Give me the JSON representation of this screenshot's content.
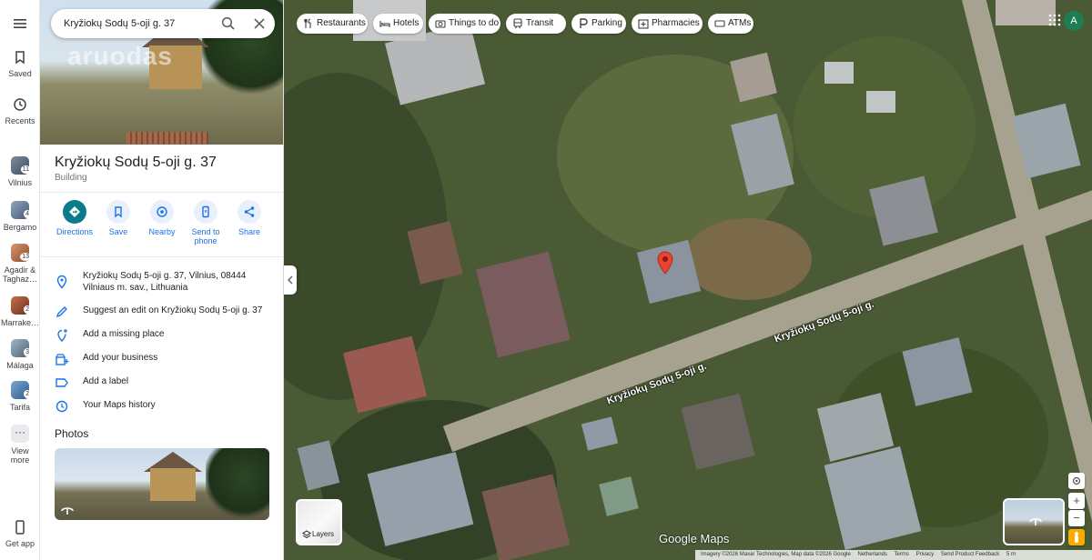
{
  "search": {
    "value": "Kryžiokų Sodų 5-oji g. 37"
  },
  "rail": {
    "saved": "Saved",
    "recents": "Recents",
    "places": [
      {
        "label": "Vilnius",
        "count": "11"
      },
      {
        "label": "Bergamo",
        "count": "4"
      },
      {
        "label": "Agadir & Taghaz…",
        "count": "13"
      },
      {
        "label": "Marrake…",
        "count": "2"
      },
      {
        "label": "Málaga",
        "count": "3"
      },
      {
        "label": "Tarifa",
        "count": "2"
      }
    ],
    "view_more": "View more",
    "get_app": "Get app"
  },
  "hero": {
    "watermark": "aruodas"
  },
  "place": {
    "title": "Kryžiokų Sodų 5-oji g. 37",
    "category": "Building"
  },
  "actions": [
    "Directions",
    "Save",
    "Nearby",
    "Send to phone",
    "Share"
  ],
  "details": {
    "address": "Kryžiokų Sodų 5-oji g. 37, Vilnius, 08444 Vilniaus m. sav., Lithuania",
    "suggest_edit": "Suggest an edit on Kryžiokų Sodų 5-oji g. 37",
    "missing_place": "Add a missing place",
    "add_business": "Add your business",
    "add_label": "Add a label",
    "history": "Your Maps history"
  },
  "photos": {
    "heading": "Photos"
  },
  "chips": [
    "Restaurants",
    "Hotels",
    "Things to do",
    "Transit",
    "Parking",
    "Pharmacies",
    "ATMs"
  ],
  "account": {
    "initial": "A"
  },
  "map": {
    "road_label_1": "Kryžiokų Sodų 5-oji g.",
    "road_label_2": "Kryžiokų Sodų 5-oji g.",
    "layers_label": "Layers",
    "logo": "Google Maps",
    "footer": {
      "imagery": "Imagery ©2026 Maxar Technologies, Map data ©2026 Google",
      "country": "Netherlands",
      "terms": "Terms",
      "privacy": "Privacy",
      "feedback": "Send Product Feedback",
      "scale": "5 m"
    }
  },
  "colors": {
    "accent": "#1a73e8",
    "directions": "#0b7a8a",
    "pin": "#ea4335",
    "avatar": "#1e7d52"
  }
}
